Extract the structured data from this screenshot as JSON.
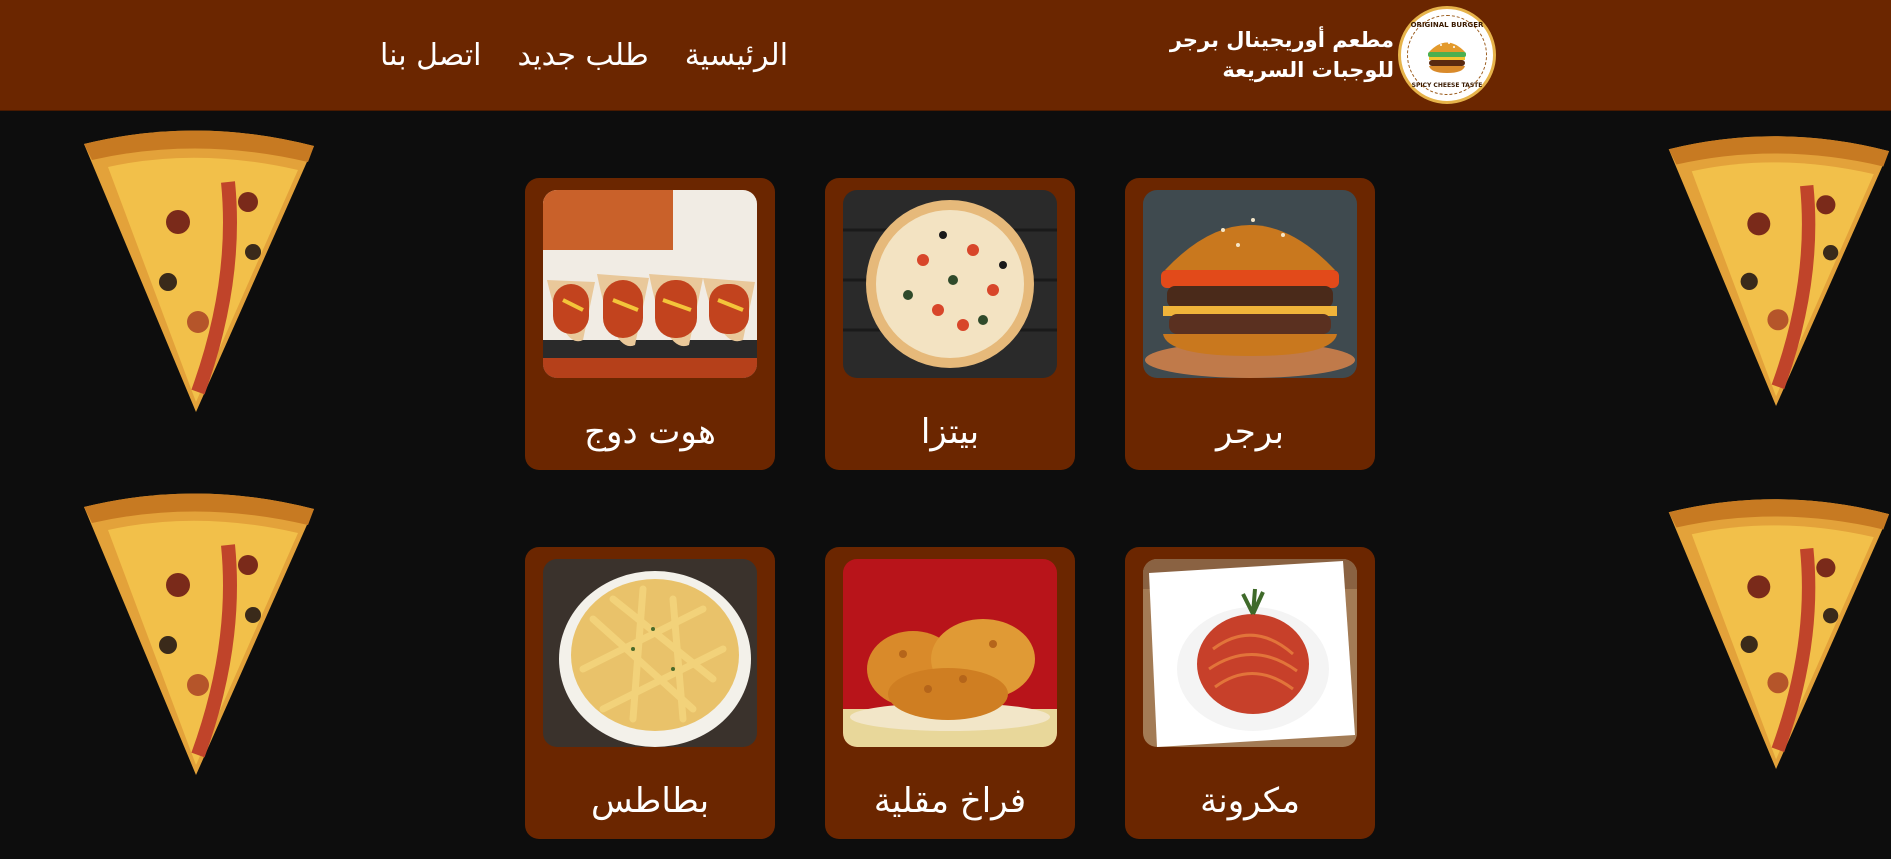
{
  "header": {
    "brand_line1": "مطعم أوريجينال برجر",
    "brand_line2": "للوجبات السريعة",
    "logo_top": "ORIGINAL BURGER",
    "logo_bottom": "SPICY CHEESE TASTE",
    "nav": [
      {
        "label": "الرئيسية"
      },
      {
        "label": "طلب جديد"
      },
      {
        "label": "اتصل بنا"
      }
    ]
  },
  "menu": {
    "items": [
      {
        "label": "برجر",
        "image": "burger-photo"
      },
      {
        "label": "بيتزا",
        "image": "pizza-photo"
      },
      {
        "label": "هوت دوج",
        "image": "hotdog-photo"
      },
      {
        "label": "مكرونة",
        "image": "pasta-photo"
      },
      {
        "label": "فراخ مقلية",
        "image": "fried-chicken-photo"
      },
      {
        "label": "بطاطس",
        "image": "fries-photo"
      }
    ]
  },
  "colors": {
    "header_bg": "#6b2600",
    "page_bg": "#0d0d0d",
    "card_bg": "#6b2600",
    "text": "#ffffff"
  }
}
